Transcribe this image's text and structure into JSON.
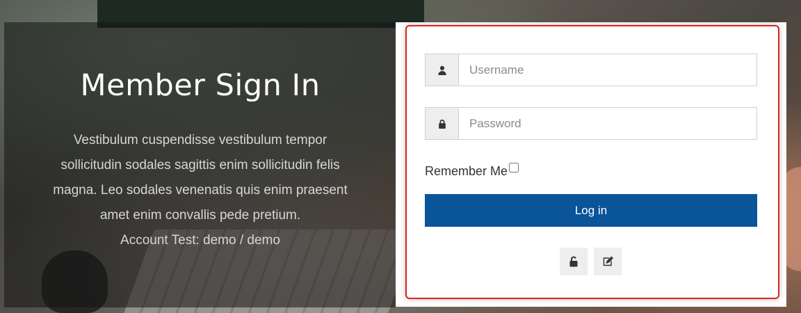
{
  "intro": {
    "title": "Member Sign In",
    "description": "Vestibulum cuspendisse vestibulum tempor sollicitudin sodales sagittis enim sollicitudin felis magna. Leo sodales venenatis quis enim praesent amet enim convallis pede pretium.",
    "account_test": "Account Test: demo / demo"
  },
  "login_form": {
    "username": {
      "placeholder": "Username",
      "value": "",
      "icon": "user-icon"
    },
    "password": {
      "placeholder": "Password",
      "value": "",
      "icon": "lock-icon"
    },
    "remember_label": "Remember Me",
    "remember_checked": false,
    "submit_label": "Log in",
    "forgot_icon": "unlock-icon",
    "register_icon": "edit-icon",
    "button_color": "#0a5499",
    "highlight_color": "#e21f1f"
  }
}
